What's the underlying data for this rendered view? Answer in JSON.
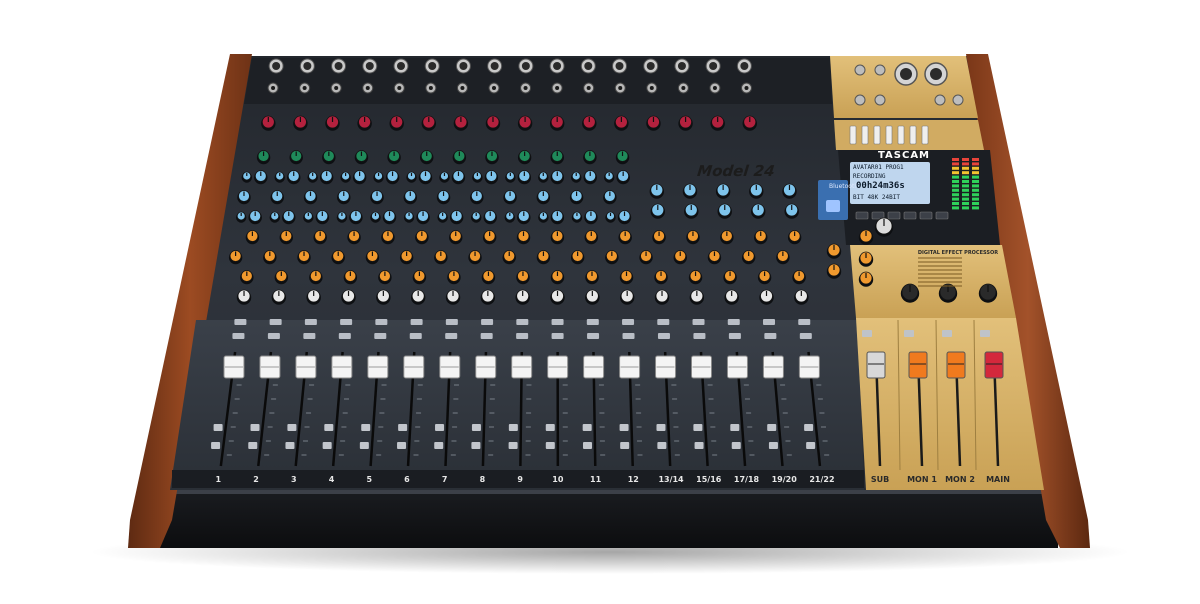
{
  "product": {
    "brand": "TASCAM",
    "model": "Model 24",
    "bluetooth_label": "Bluetooth",
    "effects_section_title": "DIGITAL EFFECT PROCESSOR"
  },
  "display": {
    "line1": "AVATAR01 PROG1",
    "line2": "RECORDING",
    "time": "00h24m36s",
    "line4": "BIT 48K 24BIT"
  },
  "channels": {
    "mono": [
      "1",
      "2",
      "3",
      "4",
      "5",
      "6",
      "7",
      "8",
      "9",
      "10",
      "11",
      "12"
    ],
    "stereo": [
      "13/14",
      "15/16",
      "17/18",
      "19/20",
      "21/22"
    ]
  },
  "master_sections": {
    "labels": [
      "SUB",
      "MON 1",
      "MON 2",
      "MAIN"
    ],
    "fader_cap_colors": [
      "#d8d8d8",
      "#f07a1e",
      "#f07a1e",
      "#d4283c"
    ]
  },
  "colors": {
    "wood": "#8a3e1c",
    "panel": "#2b3038",
    "gold_panel": "#d9b56a",
    "knob_blue": "#7ec4ec",
    "knob_orange": "#f0992e",
    "knob_green": "#1f8a5a",
    "knob_red": "#b4213e"
  }
}
